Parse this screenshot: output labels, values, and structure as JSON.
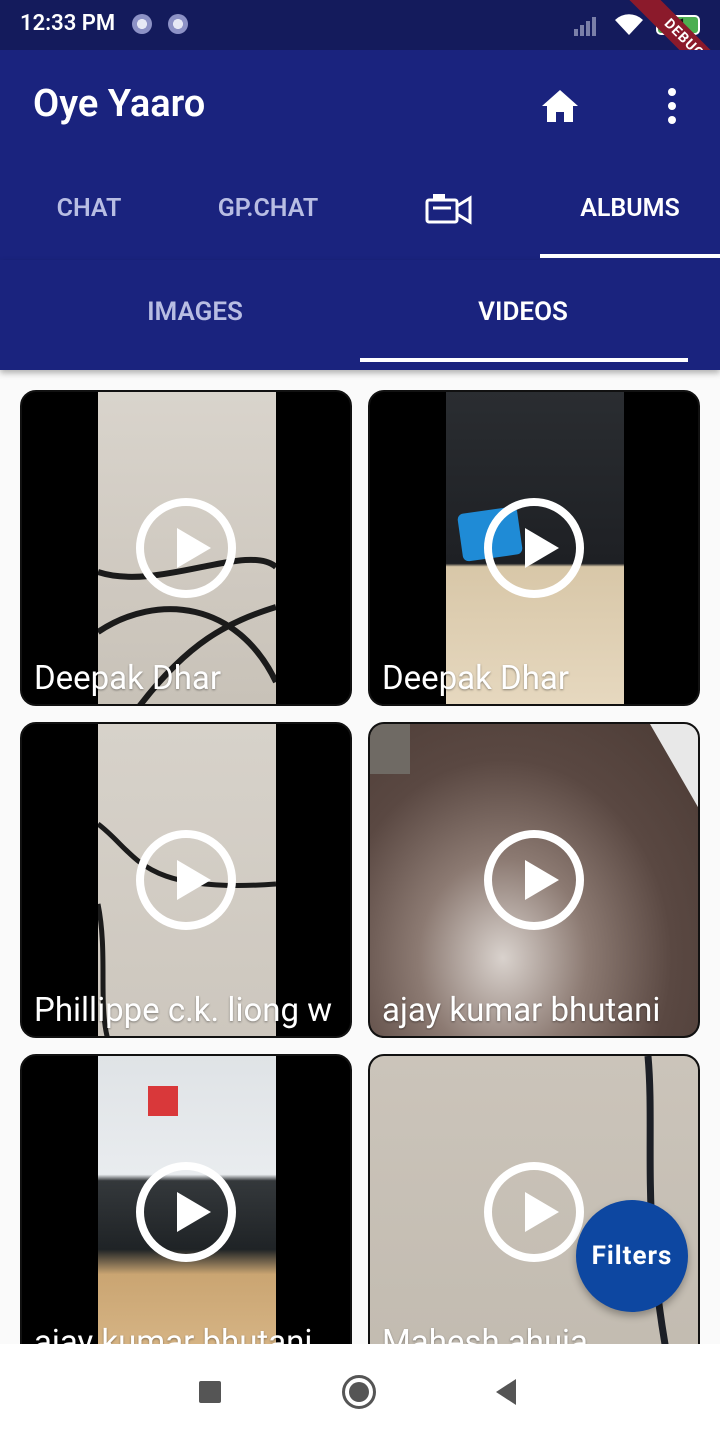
{
  "status_bar": {
    "time": "12:33 PM",
    "battery": "91",
    "debug_label": "DEBUG"
  },
  "app_bar": {
    "title": "Oye Yaaro",
    "home_icon": "home-icon",
    "menu_icon": "more-vert-icon"
  },
  "main_tabs": [
    {
      "label": "CHAT"
    },
    {
      "label": "GP.CHAT"
    },
    {
      "label": "",
      "icon": "video-camera-icon"
    },
    {
      "label": "ALBUMS",
      "active": true
    }
  ],
  "sub_tabs": [
    {
      "label": "IMAGES"
    },
    {
      "label": "VIDEOS",
      "active": true
    }
  ],
  "videos": [
    {
      "label": "Deepak Dhar"
    },
    {
      "label": "Deepak Dhar"
    },
    {
      "label": "Phillippe c.k. liong w"
    },
    {
      "label": "ajay kumar bhutani"
    },
    {
      "label": "ajay kumar bhutani"
    },
    {
      "label": "Mahesh ahuja"
    }
  ],
  "fab": {
    "label": "Filters"
  },
  "colors": {
    "app_bar": "#1a237e",
    "status_bar": "#141b5c",
    "fab": "#0d47a1"
  }
}
